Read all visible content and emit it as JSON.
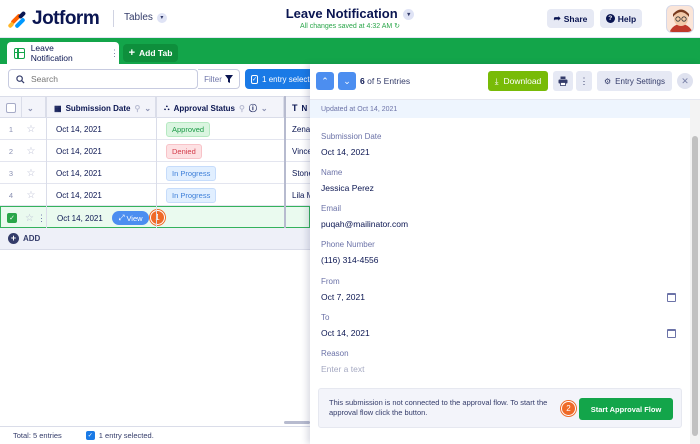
{
  "header": {
    "brand": "Jotform",
    "tables_label": "Tables",
    "form_title": "Leave Notification",
    "saved_status": "All changes saved at 4:32 AM",
    "share_label": "Share",
    "help_label": "Help"
  },
  "tabs": {
    "active_label": "Leave Notification",
    "add_label": "Add Tab"
  },
  "toolbar": {
    "search_placeholder": "Search",
    "filter_label": "Filter",
    "selected_label": "1 entry selected"
  },
  "table": {
    "columns": [
      "Submission Date",
      "Approval Status",
      "N"
    ],
    "rows": [
      {
        "num": "1",
        "date": "Oct 14, 2021",
        "status": "Approved",
        "next": "Zena"
      },
      {
        "num": "2",
        "date": "Oct 14, 2021",
        "status": "Denied",
        "next": "Vince"
      },
      {
        "num": "3",
        "date": "Oct 14, 2021",
        "status": "In Progress",
        "next": "Stone"
      },
      {
        "num": "4",
        "date": "Oct 14, 2021",
        "status": "In Progress",
        "next": "Lila M"
      },
      {
        "num": "",
        "date": "Oct 14, 2021",
        "status": "",
        "next": ""
      }
    ],
    "view_label": "View",
    "step1": "1",
    "add_label": "ADD"
  },
  "footer": {
    "total": "Total: 5 entries",
    "selected": "1 entry selected."
  },
  "panel": {
    "entries_current": "6",
    "entries_rest": "of 5 Entries",
    "download_label": "Download",
    "entry_settings_label": "Entry Settings",
    "updated": "Updated at Oct 14, 2021",
    "fields": [
      {
        "label": "Submission Date",
        "value": "Oct 14, 2021"
      },
      {
        "label": "Name",
        "value": "Jessica Perez"
      },
      {
        "label": "Email",
        "value": "puqah@mailinator.com"
      },
      {
        "label": "Phone Number",
        "value": "(116) 314-4556"
      },
      {
        "label": "From",
        "value": "Oct 7, 2021"
      },
      {
        "label": "To",
        "value": "Oct 14, 2021"
      },
      {
        "label": "Reason",
        "value": "Enter a text"
      }
    ],
    "approval_text": "This submission is not connected to the approval flow. To start the approval flow click the button.",
    "approval_button": "Start Approval Flow",
    "step2": "2"
  },
  "colors": {
    "brand_green": "#13a54a",
    "accent_blue": "#1a7ae6",
    "download_green": "#78bb07",
    "step_orange": "#ef6a28"
  }
}
